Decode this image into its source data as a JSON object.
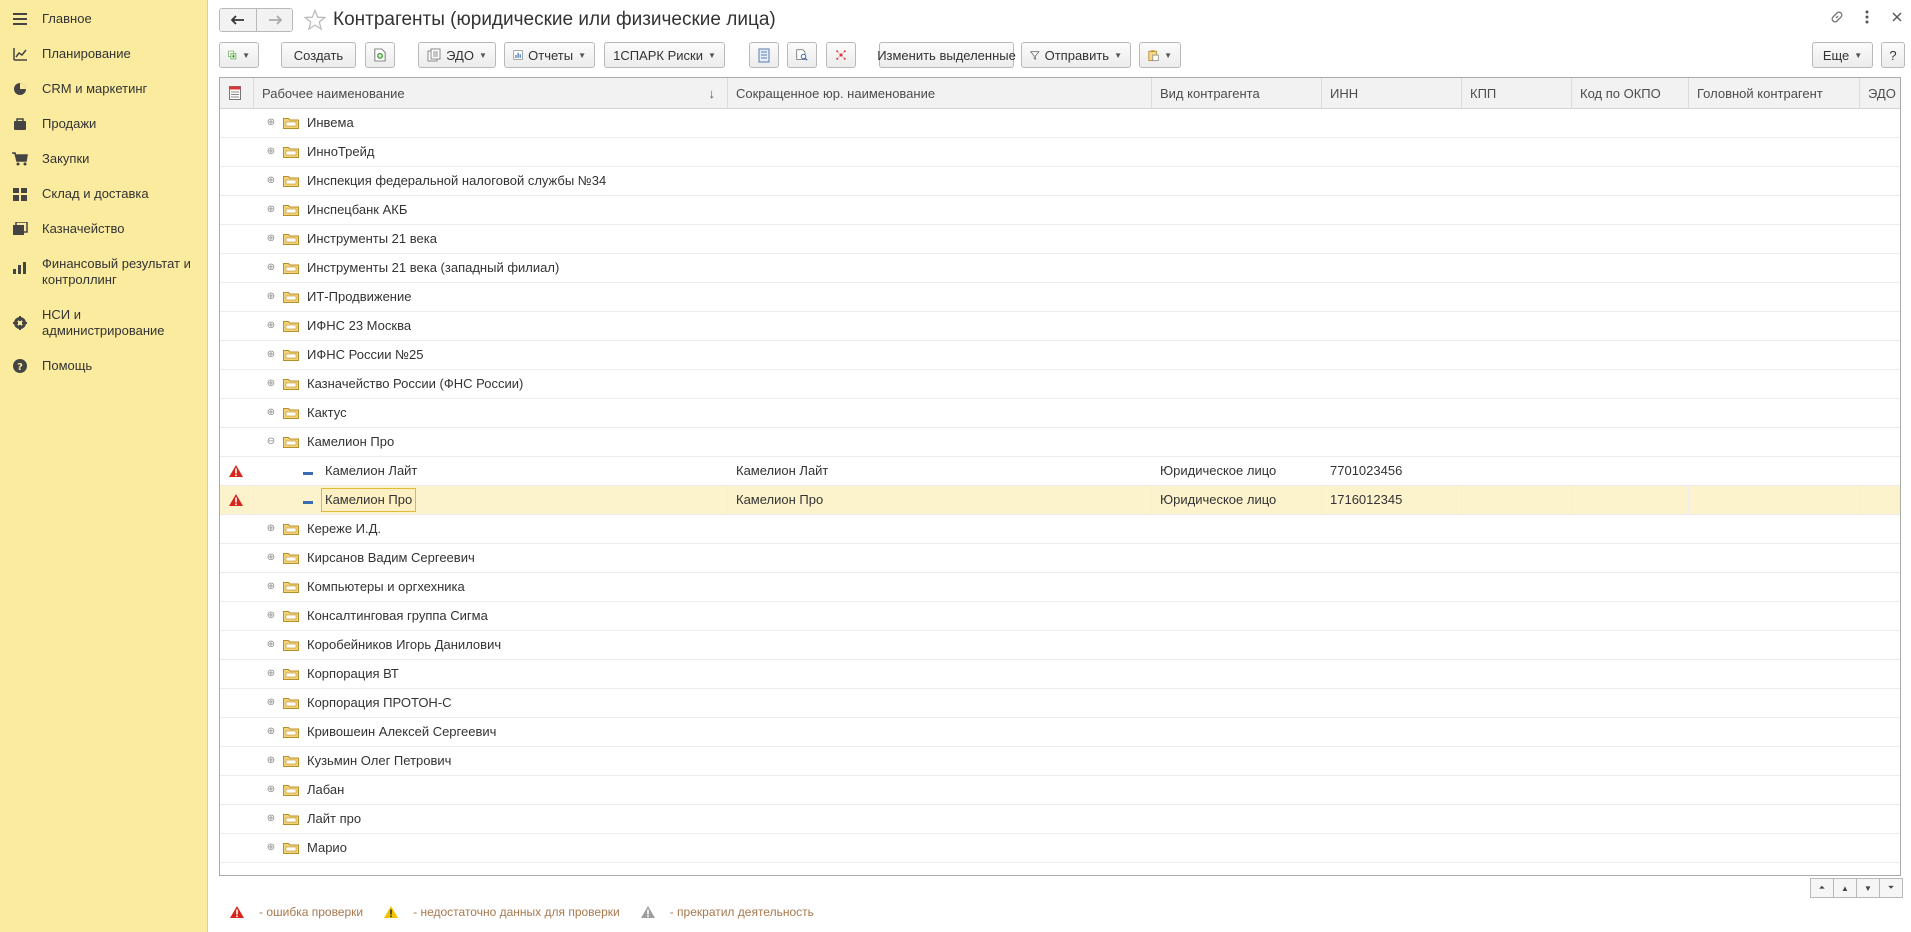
{
  "sidebar": {
    "items": [
      {
        "label": "Главное",
        "icon": "menu-icon"
      },
      {
        "label": "Планирование",
        "icon": "planning-icon"
      },
      {
        "label": "CRM и маркетинг",
        "icon": "crm-icon"
      },
      {
        "label": "Продажи",
        "icon": "sales-bag-icon"
      },
      {
        "label": "Закупки",
        "icon": "cart-icon"
      },
      {
        "label": "Склад и доставка",
        "icon": "warehouse-icon"
      },
      {
        "label": "Казначейство",
        "icon": "treasury-icon"
      },
      {
        "label": "Финансовый результат и контроллинг",
        "icon": "finance-icon"
      },
      {
        "label": "НСИ и администрирование",
        "icon": "gear-icon"
      },
      {
        "label": "Помощь",
        "icon": "help-icon"
      }
    ]
  },
  "header": {
    "title": "Контрагенты (юридические или физические лица)"
  },
  "toolbar": {
    "create_label": "Создать",
    "edo_label": "ЭДО",
    "reports_label": "Отчеты",
    "spark_label": "1СПАРК Риски",
    "change_selected_label": "Изменить выделенные",
    "send_label": "Отправить",
    "more_label": "Еще",
    "help_label": "?"
  },
  "table": {
    "columns": [
      "Рабочее наименование",
      "Сокращенное юр. наименование",
      "Вид контрагента",
      "ИНН",
      "КПП",
      "Код по ОКПО",
      "Головной контрагент",
      "ЭДО"
    ],
    "rows": [
      {
        "name": "Инвема",
        "type": "folder"
      },
      {
        "name": "ИнноТрейд",
        "type": "folder"
      },
      {
        "name": "Инспекция федеральной налоговой службы №34",
        "type": "folder"
      },
      {
        "name": "Инспецбанк АКБ",
        "type": "folder"
      },
      {
        "name": "Инструменты 21 века",
        "type": "folder"
      },
      {
        "name": "Инструменты 21 века (западный филиал)",
        "type": "folder"
      },
      {
        "name": "ИТ-Продвижение",
        "type": "folder"
      },
      {
        "name": "ИФНС 23 Москва",
        "type": "folder"
      },
      {
        "name": "ИФНС России №25",
        "type": "folder"
      },
      {
        "name": "Казначейство России (ФНС России)",
        "type": "folder"
      },
      {
        "name": "Кактус",
        "type": "folder"
      },
      {
        "name": "Камелион Про",
        "type": "folder-open"
      },
      {
        "name": "Камелион Лайт",
        "type": "item",
        "short": "Камелион Лайт",
        "kind": "Юридическое лицо",
        "inn": "7701023456",
        "status": "error"
      },
      {
        "name": "Камелион Про",
        "type": "item",
        "short": "Камелион Про",
        "kind": "Юридическое лицо",
        "inn": "1716012345",
        "status": "error",
        "selected": true
      },
      {
        "name": "Кереже И.Д.",
        "type": "folder"
      },
      {
        "name": "Кирсанов Вадим Сергеевич",
        "type": "folder"
      },
      {
        "name": "Компьютеры и оргхехника",
        "type": "folder"
      },
      {
        "name": "Консалтинговая группа Сигма",
        "type": "folder"
      },
      {
        "name": "Коробейников Игорь Данилович",
        "type": "folder"
      },
      {
        "name": "Корпорация ВТ",
        "type": "folder"
      },
      {
        "name": "Корпорация ПРОТОН-С",
        "type": "folder"
      },
      {
        "name": "Кривошеин Алексей Сергеевич",
        "type": "folder"
      },
      {
        "name": "Кузьмин Олег Петрович",
        "type": "folder"
      },
      {
        "name": "Лабан",
        "type": "folder"
      },
      {
        "name": "Лайт про",
        "type": "folder"
      },
      {
        "name": "Марио",
        "type": "folder"
      }
    ]
  },
  "legend": {
    "error": "- ошибка проверки",
    "insufficient": "- недостаточно данных для проверки",
    "stopped": "- прекратил деятельность"
  },
  "colors": {
    "sidebar_bg": "#faeb9f",
    "selected_row": "#fcf3cc",
    "error_red": "#d9261c",
    "warn_yellow": "#f2c200",
    "stopped_gray": "#9e9e9e",
    "legend_text": "#a8784d"
  }
}
